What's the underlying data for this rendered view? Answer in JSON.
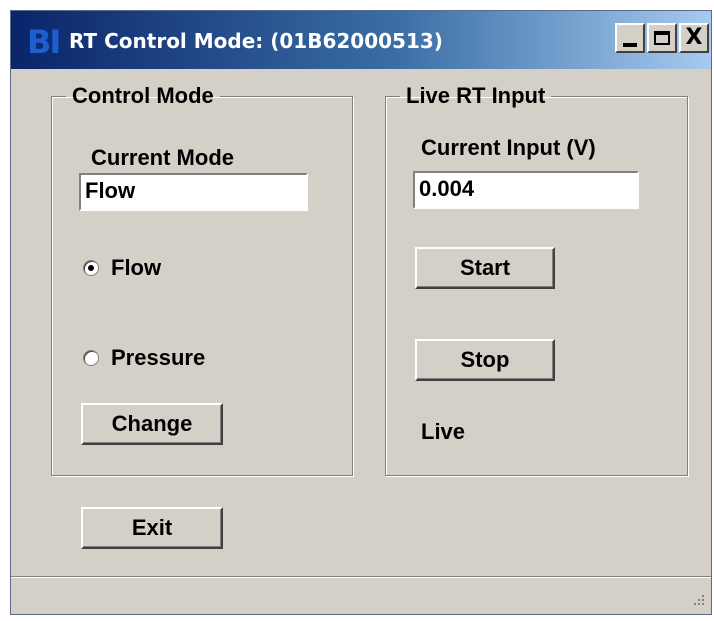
{
  "window": {
    "logo": "BI",
    "title": "RT Control Mode: (01B62000513)",
    "close_glyph": "X"
  },
  "control_mode": {
    "group_label": "Control Mode",
    "current_mode_label": "Current Mode",
    "current_mode_value": "Flow",
    "radio_options": [
      {
        "label": "Flow",
        "selected": true
      },
      {
        "label": "Pressure",
        "selected": false
      }
    ],
    "change_button": "Change"
  },
  "live_input": {
    "group_label": "Live RT Input",
    "current_input_label": "Current Input (V)",
    "current_input_value": "0.004",
    "start_button": "Start",
    "stop_button": "Stop",
    "status_text": "Live"
  },
  "exit_button": "Exit",
  "colors": {
    "window_bg": "#d4d0c8",
    "title_gradient_start": "#0a246a",
    "title_gradient_end": "#a6caf0"
  }
}
